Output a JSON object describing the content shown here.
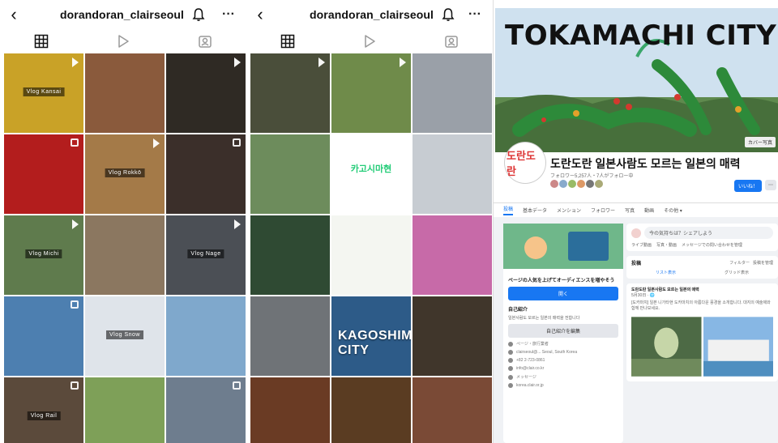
{
  "instagram": {
    "username": "dorandoran_clairseoul",
    "back_glyph": "‹",
    "more_glyph": "···",
    "icons": {
      "back": "back-icon",
      "bell": "bell-icon",
      "more": "more-icon",
      "grid": "grid-icon",
      "reels": "reels-icon",
      "tagged": "tagged-icon"
    }
  },
  "panel1_tiles": [
    {
      "cap": "Vlog Kansai",
      "bg": "#c9a227",
      "badge": "reel"
    },
    {
      "cap": "",
      "bg": "#8a5a3c",
      "badge": "none"
    },
    {
      "cap": "",
      "bg": "#2f2a24",
      "badge": "reel"
    },
    {
      "cap": "",
      "bg": "#b31d1d",
      "badge": "multi"
    },
    {
      "cap": "Vlog Rokkō",
      "bg": "#a47a48",
      "badge": "reel"
    },
    {
      "cap": "",
      "bg": "#3b2f2a",
      "badge": "multi"
    },
    {
      "cap": "Vlog Michi",
      "bg": "#5f7b4d",
      "badge": "reel"
    },
    {
      "cap": "",
      "bg": "#8b7760",
      "badge": "none"
    },
    {
      "cap": "Vlog Nage",
      "bg": "#4b4f55",
      "badge": "reel"
    },
    {
      "cap": "",
      "bg": "#4d7fb0",
      "badge": "multi"
    },
    {
      "cap": "Vlog Snow",
      "bg": "#dfe4ea",
      "badge": "none"
    },
    {
      "cap": "",
      "bg": "#7fa8cc",
      "badge": "none"
    },
    {
      "cap": "Vlog Rail",
      "bg": "#5b4a3b",
      "badge": "multi"
    },
    {
      "cap": "",
      "bg": "#7ea058",
      "badge": "none"
    },
    {
      "cap": "",
      "bg": "#6e7d8e",
      "badge": "multi"
    }
  ],
  "panel2_tiles": [
    {
      "cap": "",
      "bg": "#4a4e3a",
      "badge": "reel"
    },
    {
      "cap": "",
      "bg": "#6f8b4a",
      "badge": "reel"
    },
    {
      "cap": "",
      "bg": "#9aa0a8",
      "badge": "none"
    },
    {
      "cap": "",
      "bg": "#6d8c5c",
      "badge": "none"
    },
    {
      "cap": "",
      "bg": "#ffffff",
      "badge": "none",
      "ko": "카고시마현"
    },
    {
      "cap": "",
      "bg": "#c7ccd2",
      "badge": "none"
    },
    {
      "cap": "",
      "bg": "#2f4a33",
      "badge": "none"
    },
    {
      "cap": "",
      "bg": "#f4f6f1",
      "badge": "none"
    },
    {
      "cap": "",
      "bg": "#c76aa8",
      "badge": "none"
    },
    {
      "cap": "",
      "bg": "#6f7377",
      "badge": "none"
    },
    {
      "cap": "",
      "bg": "#2d5b88",
      "badge": "none",
      "title": "KAGOSHIMA CITY"
    },
    {
      "cap": "",
      "bg": "#40362b",
      "badge": "none"
    },
    {
      "cap": "",
      "bg": "#6a3b24",
      "badge": "none"
    },
    {
      "cap": "",
      "bg": "#5a3c22",
      "badge": "none"
    },
    {
      "cap": "",
      "bg": "#7a4a36",
      "badge": "none"
    }
  ],
  "facebook": {
    "cover_title": "TOKAMACHI CITY",
    "cover_button": "カバー写真",
    "avatar_text": "도란도란",
    "page_name": "도란도란   일본사람도 모르는 일본의 매력",
    "follow_text": "フォロワー5,257人・7人がフォロー中",
    "like_button": "いいね！",
    "message_button": "⋯",
    "nav": [
      "投稿",
      "基本データ",
      "メンション",
      "フォロワー",
      "写真",
      "動画",
      "その他 ▾"
    ],
    "intro_title": "自己紹介",
    "intro_text": "일본사람도 모르는 일본의 매력을 전합니다",
    "intro_button": "自己紹介を編集",
    "promo_text": "ページの人気を上げてオーディエンスを増やそう",
    "promo_button": "開く",
    "info_rows": [
      "ページ・旅行業者",
      "clairseoul@... Seoul, South Korea",
      "+82 2-723-0861",
      "info@clair.co.kr",
      "メッセージ",
      "korea.clair.or.jp"
    ],
    "composer_placeholder": "今の気持ちは？シェアしよう",
    "composer_actions": [
      "ライブ動画",
      "写真・動画",
      "メッセージでの問い合わせを管理"
    ],
    "posts_label": "投稿",
    "filter_label": "フィルター",
    "manage_label": "投稿を管理",
    "list_view": "リスト表示",
    "grid_view": "グリッド表示",
    "post_author": "도란도란 일본사람도 모르는 일본의 매력",
    "post_meta": "5月30日 · 🌐",
    "post_body": "[도카마치] 일본 니가타현 도카마치의 아름다운 풍경을 소개합니다. 대지의 예술제와 함께 만나보세요."
  },
  "colors": {
    "accent": "#1877f2",
    "ig_text": "#111111",
    "fb_bg": "#f0f2f5"
  }
}
